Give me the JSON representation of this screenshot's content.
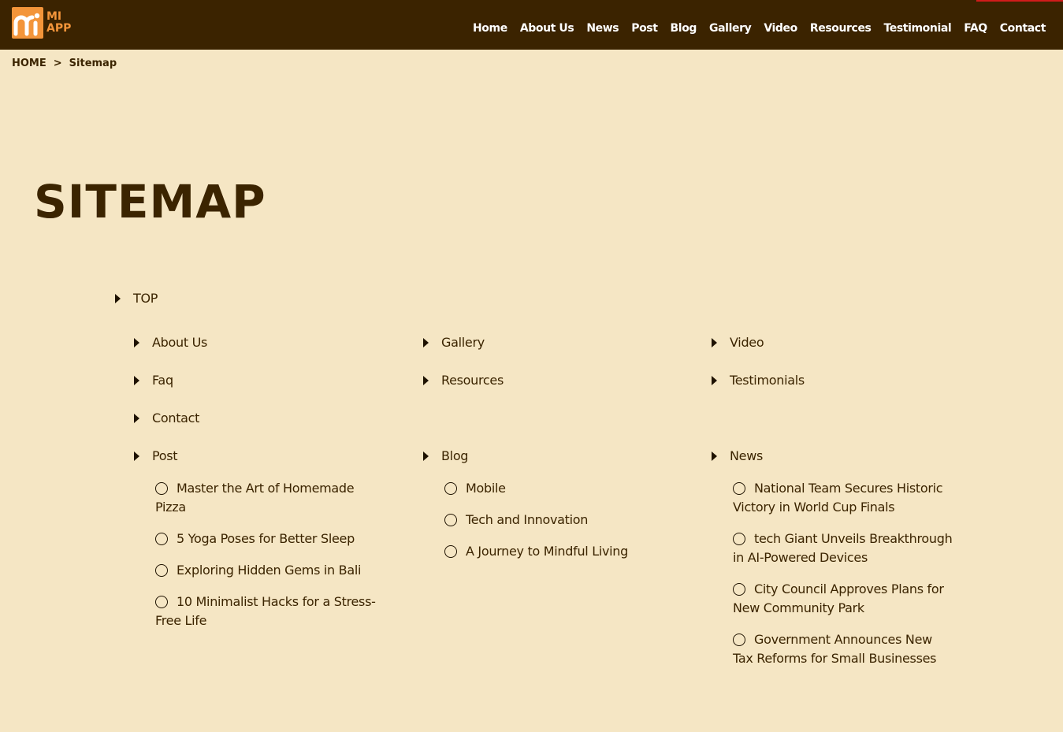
{
  "logo": {
    "line1": "MI",
    "line2": "APP",
    "accent_color": "#f3953a"
  },
  "header": {
    "bg_color": "#3b2300"
  },
  "nav": [
    "Home",
    "About Us",
    "News",
    "Post",
    "Blog",
    "Gallery",
    "Video",
    "Resources",
    "Testimonial",
    "FAQ",
    "Contact"
  ],
  "breadcrumb": {
    "home": "HOME",
    "sep": ">",
    "current": "Sitemap"
  },
  "title": "SITEMAP",
  "sitemap": {
    "top": "TOP",
    "col1": {
      "about": "About Us",
      "faq": "Faq",
      "contact": "Contact",
      "post": "Post"
    },
    "col2": {
      "gallery": "Gallery",
      "resources": "Resources",
      "blog": "Blog"
    },
    "col3": {
      "video": "Video",
      "testimonials": "Testimonials",
      "news": "News"
    },
    "post_items": [
      "Master the Art of Homemade Pizza",
      "5 Yoga Poses for Better Sleep",
      "Exploring Hidden Gems in Bali",
      "10 Minimalist Hacks for a Stress-Free Life"
    ],
    "blog_items": [
      "Mobile",
      "Tech and Innovation",
      "A Journey to Mindful Living"
    ],
    "news_items": [
      "National Team Secures Historic Victory in World Cup Finals",
      "tech Giant Unveils Breakthrough in AI-Powered Devices",
      "City Council Approves Plans for New Community Park",
      "Government Announces New Tax Reforms for Small Businesses"
    ]
  }
}
